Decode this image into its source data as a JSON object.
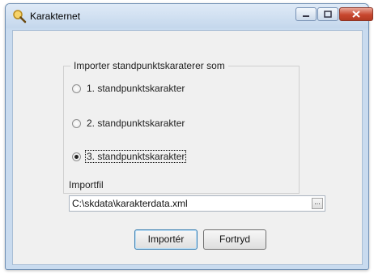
{
  "window": {
    "title": "Karakternet",
    "icon": "magnifier-icon"
  },
  "group": {
    "legend": "Importer standpunktskaraterer som",
    "options": [
      {
        "label": "1. standpunktskarakter",
        "checked": false
      },
      {
        "label": "2. standpunktskarakter",
        "checked": false
      },
      {
        "label": "3. standpunktskarakter",
        "checked": true
      }
    ]
  },
  "import_file": {
    "label": "Importfil",
    "value": "C:\\skdata\\karakterdata.xml",
    "browse_label": "..."
  },
  "buttons": {
    "import": "Importér",
    "cancel": "Fortryd"
  },
  "colors": {
    "titlebar": "#c4d7ec",
    "close_button": "#c8472f",
    "client_background": "#f0f0f0"
  }
}
